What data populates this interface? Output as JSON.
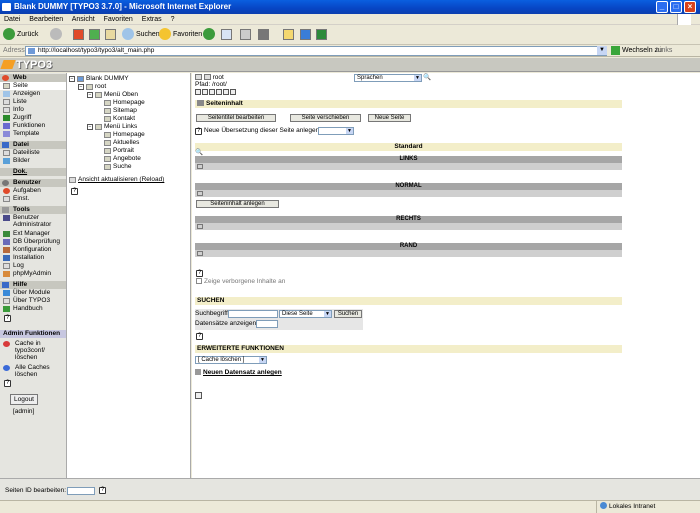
{
  "window": {
    "title": "Blank DUMMY [TYPO3 3.7.0] - Microsoft Internet Explorer"
  },
  "menubar": [
    "Datei",
    "Bearbeiten",
    "Ansicht",
    "Favoriten",
    "Extras",
    "?"
  ],
  "toolbar": {
    "back": "Zurück",
    "search": "Suchen",
    "favorites": "Favoriten"
  },
  "address": {
    "label": "Adresse",
    "url": "http://localhost/typo3/typo3/alt_main.php",
    "go": "Wechseln zu",
    "links": "Links"
  },
  "typo3": {
    "logo": "TYPO3"
  },
  "leftnav": {
    "web": {
      "header": "Web",
      "items": [
        "Seite",
        "Anzeigen",
        "Liste",
        "Info",
        "Zugriff",
        "Funktionen",
        "Template"
      ]
    },
    "datei": {
      "header": "Datei",
      "items": [
        "Dateiliste",
        "Bilder"
      ]
    },
    "dok": {
      "header": "Dok."
    },
    "benutzer": {
      "header": "Benutzer",
      "items": [
        "Aufgaben",
        "Einst."
      ]
    },
    "tools": {
      "header": "Tools",
      "items": [
        "Benutzer Administrator",
        "Ext Manager",
        "DB Überprüfung",
        "Konfiguration",
        "Installation",
        "Log",
        "phpMyAdmin"
      ]
    },
    "hilfe": {
      "header": "Hilfe",
      "items": [
        "Über Module",
        "Über TYPO3",
        "Handbuch"
      ]
    },
    "admin": {
      "header": "Admin Funktionen",
      "clear_typo3conf": "Cache in typo3conf/ löschen",
      "clear_all": "Alle Caches löschen"
    },
    "logout": "Logout",
    "user": "[admin]"
  },
  "tree": {
    "root_site": "Blank DUMMY",
    "root": "root",
    "menu_oben": "Menü Oben",
    "oben_children": [
      "Homepage",
      "Sitemap",
      "Kontakt"
    ],
    "menu_links": "Menü Links",
    "links_children": [
      "Homepage",
      "Aktuelles",
      "Portrait",
      "Angebote",
      "Suche"
    ],
    "reload": "Ansicht aktualisieren (Reload)"
  },
  "main": {
    "page_title": "root",
    "path": "Pfad: /root/",
    "language_select": "Sprachen",
    "content_header": "Seiteninhalt",
    "btn_edit_title": "Seitentitel bearbeiten",
    "btn_move": "Seite verschieben",
    "btn_new": "Neue Seite",
    "translation_label": "Neue Übersetzung dieser Seite anlegen:",
    "standard": "Standard",
    "col_links": "LINKS",
    "col_normal": "NORMAL",
    "btn_create_content": "Seiteninhalt anlegen",
    "col_rechts": "RECHTS",
    "col_rand": "RAND",
    "hidden_content": "Zeige verborgene Inhalte an",
    "search_header": "SUCHEN",
    "search_label": "Suchbegriff:",
    "search_scope": "Diese Seite",
    "search_button": "Suchen",
    "records_label": "Datensätze anzeigen:",
    "ext_header": "ERWEITERTE FUNKTIONEN",
    "cache_select": "[ Cache löschen ]",
    "new_record": "Neuen Datensatz anlegen"
  },
  "bottom": {
    "page_id_label": "Seiten ID bearbeiten:"
  },
  "status": {
    "zone": "Lokales Intranet"
  }
}
